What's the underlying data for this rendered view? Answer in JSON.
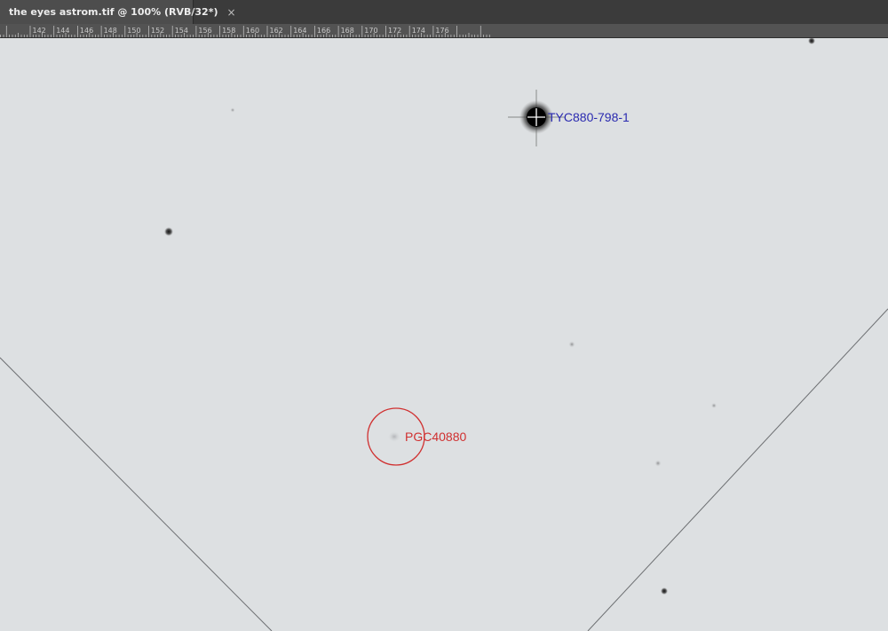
{
  "document_tab": {
    "title": "the eyes astrom.tif @ 100% (RVB/32*)",
    "close_glyph": "×"
  },
  "ruler": {
    "labels": [
      "142",
      "144",
      "146",
      "148",
      "150",
      "152",
      "154",
      "156",
      "158",
      "160",
      "162",
      "164",
      "166",
      "168",
      "170",
      "172",
      "174",
      "176"
    ]
  },
  "annotations": {
    "star_label": "TYC880-798-1",
    "galaxy_label": "PGC40880",
    "star_color": "#2a2ab0",
    "galaxy_color": "#d03030"
  },
  "icons": {
    "crosshair": "crosshair-icon",
    "circle_marker": "circle-marker-icon"
  }
}
